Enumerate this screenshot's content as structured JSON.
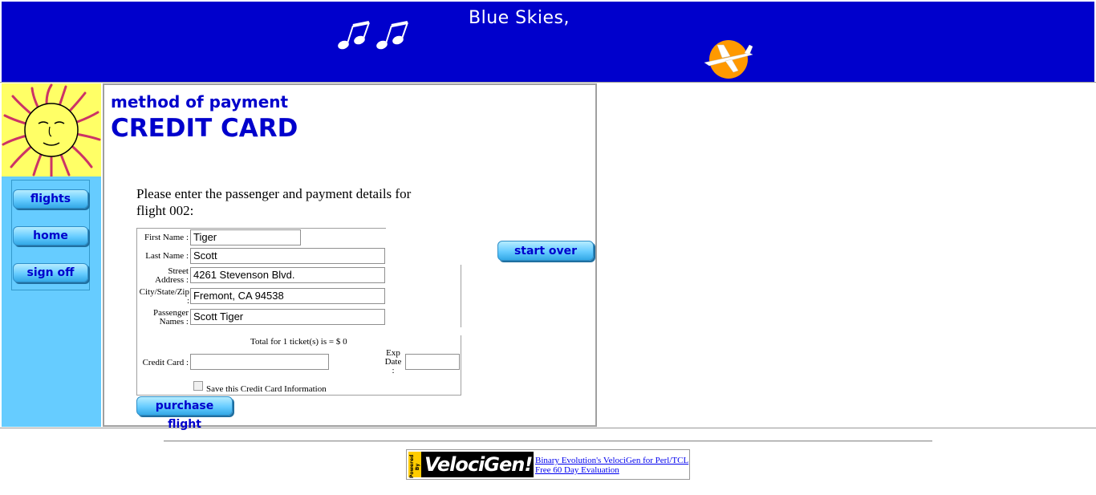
{
  "banner": {
    "title": "Blue Skies,",
    "notes_icon": "music-notes-icon",
    "logo_icon": "sun-plane-logo-icon",
    "bg_color": "#0000cc"
  },
  "sidebar": {
    "logo_icon": "sun-face-icon",
    "bg_color": "#66ccff",
    "nav": [
      {
        "label": "flights"
      },
      {
        "label": "home"
      },
      {
        "label": "sign off"
      }
    ]
  },
  "main": {
    "heading_small": "method of payment",
    "heading_large": "CREDIT CARD",
    "intro_line1": "Please enter the passenger and payment details for",
    "intro_line2": "flight 002:",
    "form": {
      "first_name_label": "First Name :",
      "first_name_value": "Tiger",
      "last_name_label": "Last Name :",
      "last_name_value": "Scott",
      "street_label_1": "Street",
      "street_label_2": "Address :",
      "street_value": "4261 Stevenson Blvd.",
      "city_label_1": "City/State/Zip",
      "city_label_2": ":",
      "city_value": "Fremont, CA 94538",
      "passenger_label_1": "Passenger",
      "passenger_label_2": "Names :",
      "passenger_value": "Scott Tiger",
      "total_text": "Total for 1 ticket(s) is = $ 0",
      "credit_card_label": "Credit Card :",
      "credit_card_value": "",
      "exp_label_1": "Exp",
      "exp_label_2": "Date",
      "exp_label_3": ":",
      "exp_value": "",
      "save_label": "Save this Credit Card Information",
      "save_checked": false
    },
    "start_over_label": "start over",
    "purchase_label": "purchase flight"
  },
  "footer": {
    "badge_powered": "Powered By",
    "badge_text": "VelociGen!",
    "link_line1": "Binary Evolution's VelociGen for Perl/TCL",
    "link_line2": "Free 60 Day Evaluation"
  }
}
